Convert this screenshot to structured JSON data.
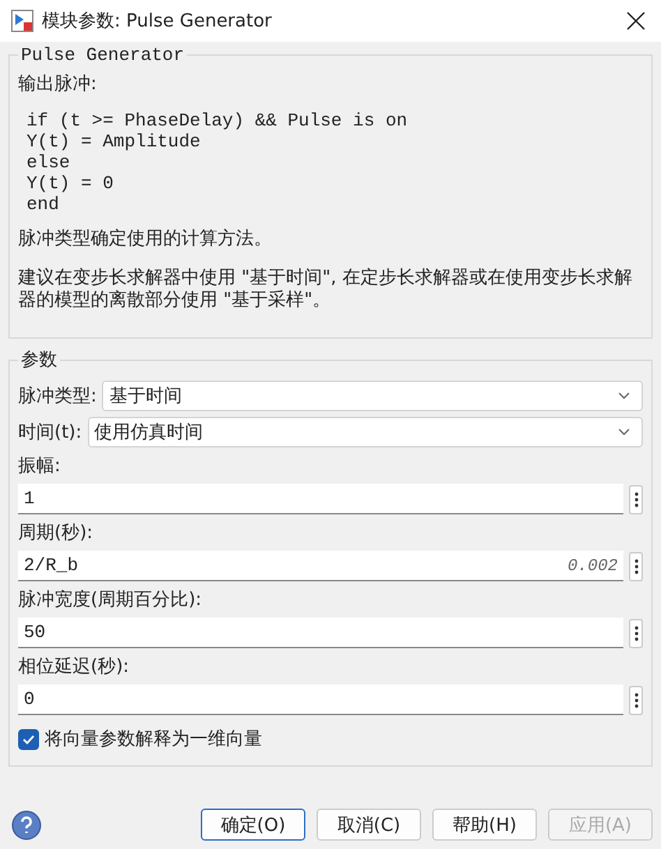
{
  "window": {
    "title": "模块参数: Pulse Generator"
  },
  "description": {
    "title": "Pulse Generator",
    "intro": "输出脉冲:",
    "code": [
      "if (t >= PhaseDelay) && Pulse is on",
      "Y(t) = Amplitude",
      "else",
      "Y(t) = 0",
      "end"
    ],
    "paragraphs": [
      "脉冲类型确定使用的计算方法。",
      "建议在变步长求解器中使用 \"基于时间\", 在定步长求解器或在使用变步长求解器的模型的离散部分使用 \"基于采样\"。"
    ]
  },
  "parameters": {
    "title": "参数",
    "items": [
      {
        "kind": "dropdown",
        "label": "脉冲类型:",
        "value": "基于时间"
      },
      {
        "kind": "dropdown",
        "label": "时间(t):",
        "value": "使用仿真时间"
      },
      {
        "kind": "field",
        "label": "振幅:",
        "value": "1"
      },
      {
        "kind": "field",
        "label": "周期(秒):",
        "value": "2/R_b",
        "hint": "0.002"
      },
      {
        "kind": "field",
        "label": "脉冲宽度(周期百分比):",
        "value": "50"
      },
      {
        "kind": "field",
        "label": "相位延迟(秒):",
        "value": "0"
      }
    ],
    "checkbox": {
      "label": "将向量参数解释为一维向量",
      "checked": true
    }
  },
  "buttons": [
    {
      "label": "确定(O)",
      "default": true,
      "disabled": false
    },
    {
      "label": "取消(C)",
      "default": false,
      "disabled": false
    },
    {
      "label": "帮助(H)",
      "default": false,
      "disabled": false
    },
    {
      "label": "应用(A)",
      "default": false,
      "disabled": true
    }
  ]
}
